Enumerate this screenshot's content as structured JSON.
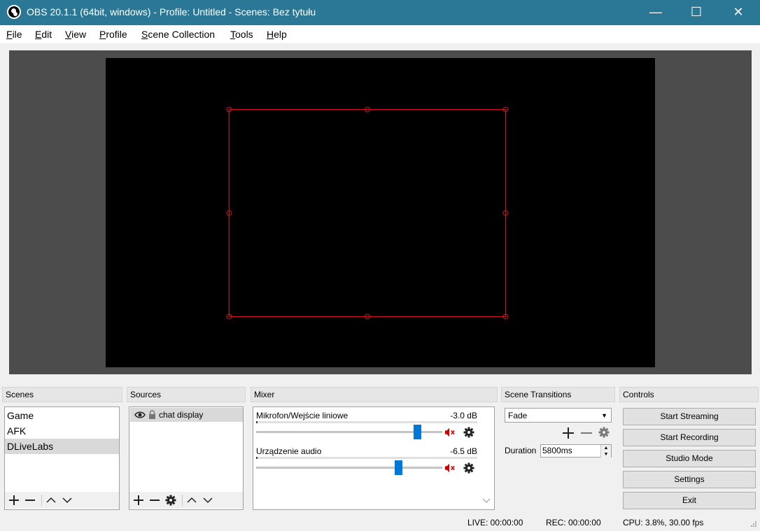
{
  "window": {
    "title": "OBS 20.1.1 (64bit, windows) - Profile: Untitled - Scenes: Bez tytułu",
    "controls": {
      "minimize": "—",
      "maximize": "☐",
      "close": "✕"
    }
  },
  "menu": [
    {
      "u": "F",
      "rest": "ile"
    },
    {
      "u": "E",
      "rest": "dit"
    },
    {
      "u": "V",
      "rest": "iew"
    },
    {
      "u": "P",
      "rest": "rofile"
    },
    {
      "u": "S",
      "rest": "cene Collection"
    },
    {
      "u": "T",
      "rest": "ools"
    },
    {
      "u": "H",
      "rest": "elp"
    }
  ],
  "colors": {
    "titlebar": "#2b7896",
    "preview_bg": "#4c4c4c",
    "selection_box": "#d01020",
    "slider_handle": "#0078d7",
    "mute_icon": "#cc0000"
  },
  "scenes": {
    "header": "Scenes",
    "items": [
      "Game",
      "AFK",
      "DLiveLabs"
    ],
    "selected": "DLiveLabs"
  },
  "sources": {
    "header": "Sources",
    "items": [
      {
        "label": "chat display",
        "visible": true,
        "locked": true
      }
    ]
  },
  "mixer": {
    "header": "Mixer",
    "tracks": [
      {
        "name": "Mikrofon/Wejście liniowe",
        "db": "-3.0 dB",
        "volume_fraction": 0.86,
        "muted": true
      },
      {
        "name": "Urządzenie audio",
        "db": "-6.5 dB",
        "volume_fraction": 0.76,
        "muted": true
      }
    ]
  },
  "transitions": {
    "header": "Scene Transitions",
    "selected": "Fade",
    "duration_label": "Duration",
    "duration_value": "5800ms"
  },
  "controls": {
    "header": "Controls",
    "buttons": [
      "Start Streaming",
      "Start Recording",
      "Studio Mode",
      "Settings",
      "Exit"
    ]
  },
  "status": {
    "live": "LIVE: 00:00:00",
    "rec": "REC: 00:00:00",
    "cpu": "CPU: 3.8%, 30.00 fps"
  }
}
